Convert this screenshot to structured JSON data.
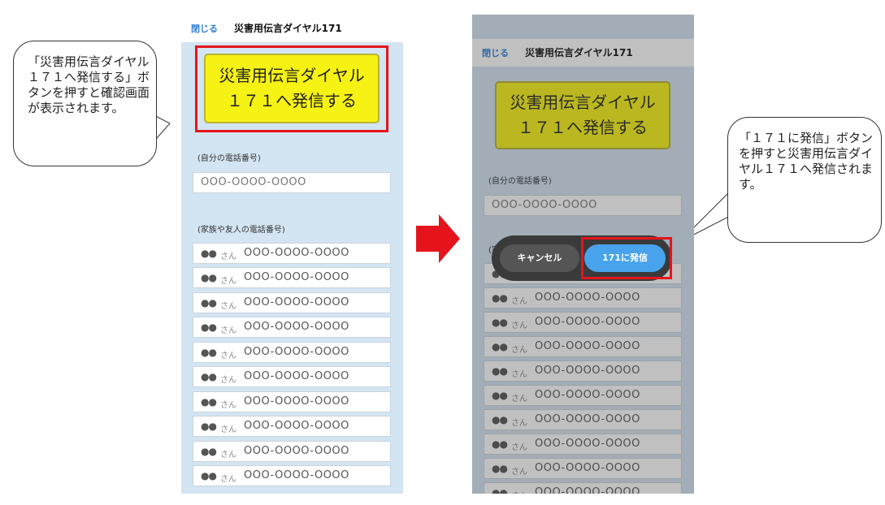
{
  "callouts": {
    "left": "「災害用伝言ダイヤル１７１へ発信する」ボタンを押すと確認画面が表示されます。",
    "right": "「１７１に発信」ボタンを押すと災害用伝言ダイヤル１７１へ発信されます。"
  },
  "screen": {
    "close_label": "閉じる",
    "title": "災害用伝言ダイヤル171",
    "dial_button": {
      "line1": "災害用伝言ダイヤル",
      "line2": "１７１へ発信する"
    },
    "own_number_label": "(自分の電話番号)",
    "own_number_placeholder": "OOO-OOOO-OOOO",
    "contacts_label": "(家族や友人の電話番号)",
    "contacts": [
      {
        "name_mark": "●●",
        "suffix": "さん",
        "number": "OOO-OOOO-OOOO"
      },
      {
        "name_mark": "●●",
        "suffix": "さん",
        "number": "OOO-OOOO-OOOO"
      },
      {
        "name_mark": "●●",
        "suffix": "さん",
        "number": "OOO-OOOO-OOOO"
      },
      {
        "name_mark": "●●",
        "suffix": "さん",
        "number": "OOO-OOOO-OOOO"
      },
      {
        "name_mark": "●●",
        "suffix": "さん",
        "number": "OOO-OOOO-OOOO"
      },
      {
        "name_mark": "●●",
        "suffix": "さん",
        "number": "OOO-OOOO-OOOO"
      },
      {
        "name_mark": "●●",
        "suffix": "さん",
        "number": "OOO-OOOO-OOOO"
      },
      {
        "name_mark": "●●",
        "suffix": "さん",
        "number": "OOO-OOOO-OOOO"
      },
      {
        "name_mark": "●●",
        "suffix": "さん",
        "number": "OOO-OOOO-OOOO"
      },
      {
        "name_mark": "●●",
        "suffix": "さん",
        "number": "OOO-OOOO-OOOO"
      }
    ]
  },
  "dialog": {
    "cancel_label": "キャンセル",
    "call_label": "171に発信"
  },
  "colors": {
    "highlight": "#e5141c",
    "arrow": "#e5141c",
    "dial_button_bg": "#f6f214",
    "screen_bg": "#d3e4f2",
    "call_button": "#48a3ec",
    "link": "#2f7fd5"
  },
  "icons": {
    "arrow": "arrow-right-icon"
  }
}
